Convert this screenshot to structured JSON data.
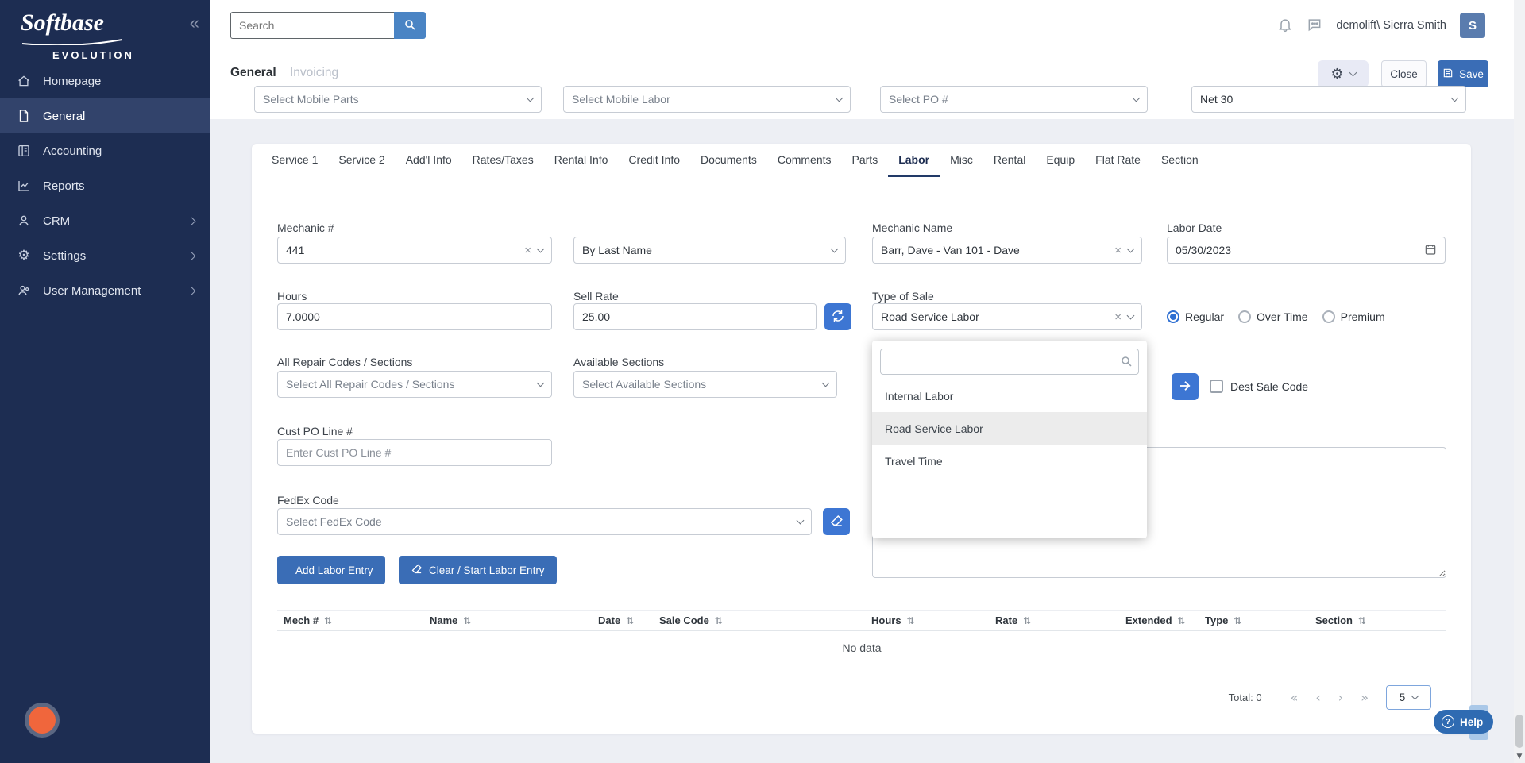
{
  "colors": {
    "sidebar": "#1d2d52",
    "primary_button": "#3a6db6",
    "icon_button": "#3d76d3",
    "accent_orange": "#f0663c",
    "radio_selected": "#2e6fd2",
    "help": "#2f6bb2"
  },
  "brand": {
    "script": "Softbase",
    "caps": "EVOLUTION"
  },
  "sidebar": {
    "items": [
      {
        "label": "Homepage"
      },
      {
        "label": "General"
      },
      {
        "label": "Accounting"
      },
      {
        "label": "Reports"
      },
      {
        "label": "CRM"
      },
      {
        "label": "Settings"
      },
      {
        "label": "User Management"
      }
    ],
    "active": "General"
  },
  "topbar": {
    "search_placeholder": "Search",
    "user": "demolift\\ Sierra Smith",
    "avatar": "S"
  },
  "header": {
    "module_tabs": [
      {
        "label": "General"
      },
      {
        "label": "Invoicing"
      }
    ],
    "active_module": "General",
    "close": "Close",
    "save": "Save"
  },
  "filter_row": {
    "mobile_parts": "Select Mobile Parts",
    "mobile_labor": "Select Mobile Labor",
    "po": "Select PO #",
    "terms": "Net 30"
  },
  "tabs": {
    "items": [
      {
        "label": "Service 1"
      },
      {
        "label": "Service 2"
      },
      {
        "label": "Add'l Info"
      },
      {
        "label": "Rates/Taxes"
      },
      {
        "label": "Rental Info"
      },
      {
        "label": "Credit Info"
      },
      {
        "label": "Documents"
      },
      {
        "label": "Comments"
      },
      {
        "label": "Parts"
      },
      {
        "label": "Labor"
      },
      {
        "label": "Misc"
      },
      {
        "label": "Rental"
      },
      {
        "label": "Equip"
      },
      {
        "label": "Flat Rate"
      },
      {
        "label": "Section"
      }
    ],
    "active": "Labor"
  },
  "form": {
    "mechanic_number": {
      "label": "Mechanic #",
      "value": "441"
    },
    "name_sort": {
      "value": "By Last Name"
    },
    "mechanic_name": {
      "label": "Mechanic Name",
      "value": "Barr, Dave - Van 101 - Dave"
    },
    "labor_date": {
      "label": "Labor Date",
      "value": "05/30/2023"
    },
    "hours": {
      "label": "Hours",
      "value": "7.0000"
    },
    "sell_rate": {
      "label": "Sell Rate",
      "value": "25.00"
    },
    "type_of_sale": {
      "label": "Type of Sale",
      "value": "Road Service Labor"
    },
    "rate_type": {
      "options": [
        "Regular",
        "Over Time",
        "Premium"
      ],
      "selected": "Regular"
    },
    "all_repair_codes": {
      "label": "All Repair Codes / Sections",
      "placeholder": "Select All Repair Codes / Sections"
    },
    "available_sections": {
      "label": "Available Sections",
      "placeholder": "Select Available Sections"
    },
    "dest_sale_code": {
      "label": "Dest Sale Code",
      "checked": false
    },
    "cust_po_line": {
      "label": "Cust PO Line #",
      "placeholder": "Enter Cust PO Line #"
    },
    "fedex_code": {
      "label": "FedEx Code",
      "placeholder": "Select FedEx Code"
    },
    "add_button": "Add Labor Entry",
    "clear_button": "Clear / Start Labor Entry"
  },
  "type_dropdown": {
    "options": [
      {
        "label": "Internal Labor"
      },
      {
        "label": "Road Service Labor"
      },
      {
        "label": "Travel Time"
      }
    ],
    "highlighted": "Road Service Labor"
  },
  "table": {
    "columns": [
      {
        "label": "Mech #"
      },
      {
        "label": "Name"
      },
      {
        "label": "Date"
      },
      {
        "label": "Sale Code"
      },
      {
        "label": "Hours"
      },
      {
        "label": "Rate"
      },
      {
        "label": "Extended"
      },
      {
        "label": "Type"
      },
      {
        "label": "Section"
      }
    ],
    "empty": "No data",
    "total": "Total: 0",
    "page_size": "5"
  },
  "help_label": "Help",
  "icons": {
    "sort": "⇅",
    "collapse": "«",
    "clear": "×",
    "pag_first": "«",
    "pag_prev": "‹",
    "pag_next": "›",
    "pag_last": "»",
    "gear": "⚙",
    "question": "?"
  }
}
